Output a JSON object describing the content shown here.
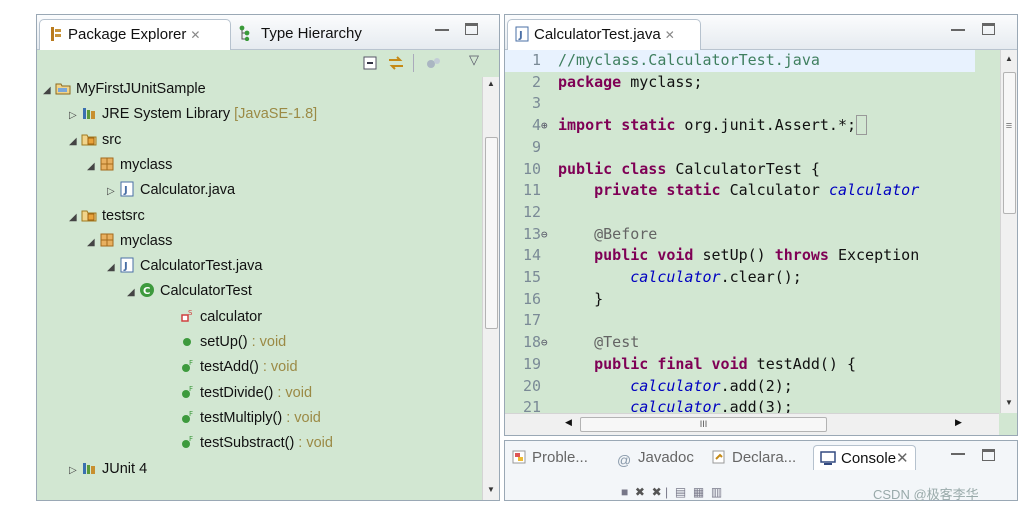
{
  "package_explorer": {
    "tab_label": "Package Explorer",
    "close_glyph": "✕",
    "type_hierarchy_label": "Type Hierarchy",
    "tree": [
      {
        "label": "MyFirstJUnitSample",
        "suffix": "",
        "icon": "project-icon",
        "twisty": "◢"
      },
      {
        "label": "JRE System Library",
        "suffix": "[JavaSE-1.8]",
        "icon": "library-icon",
        "twisty": "▷"
      },
      {
        "label": "src",
        "suffix": "",
        "icon": "source-folder-icon",
        "twisty": "◢"
      },
      {
        "label": "myclass",
        "suffix": "",
        "icon": "package-icon",
        "twisty": "◢"
      },
      {
        "label": "Calculator.java",
        "suffix": "",
        "icon": "java-file-icon",
        "twisty": "▷"
      },
      {
        "label": "testsrc",
        "suffix": "",
        "icon": "source-folder-icon",
        "twisty": "◢"
      },
      {
        "label": "myclass",
        "suffix": "",
        "icon": "package-icon",
        "twisty": "◢"
      },
      {
        "label": "CalculatorTest.java",
        "suffix": "",
        "icon": "java-file-icon",
        "twisty": "◢"
      },
      {
        "label": "CalculatorTest",
        "suffix": "",
        "icon": "class-icon",
        "twisty": "◢"
      },
      {
        "label": "calculator",
        "suffix": "",
        "icon": "static-field-icon",
        "twisty": ""
      },
      {
        "label": "setUp()",
        "suffix": ": void",
        "icon": "public-method-icon",
        "twisty": ""
      },
      {
        "label": "testAdd()",
        "suffix": ": void",
        "icon": "final-method-icon",
        "twisty": ""
      },
      {
        "label": "testDivide()",
        "suffix": ": void",
        "icon": "final-method-icon",
        "twisty": ""
      },
      {
        "label": "testMultiply()",
        "suffix": ": void",
        "icon": "final-method-icon",
        "twisty": ""
      },
      {
        "label": "testSubstract()",
        "suffix": ": void",
        "icon": "final-method-icon",
        "twisty": ""
      },
      {
        "label": "JUnit 4",
        "suffix": "",
        "icon": "library-icon",
        "twisty": "▷"
      }
    ]
  },
  "editor": {
    "tab_label": "CalculatorTest.java",
    "close_glyph": "✕",
    "lines": [
      {
        "n": "1",
        "fold": "",
        "html": "<span class=\"cm\">//myclass.CalculatorTest.java</span>"
      },
      {
        "n": "2",
        "fold": "",
        "html": "<span class=\"kw\">package</span> myclass;"
      },
      {
        "n": "3",
        "fold": "",
        "html": ""
      },
      {
        "n": "4",
        "fold": "⊕",
        "html": "<span class=\"kw\">import</span> <span class=\"kw\">static</span> org.junit.Assert.*;<span style=\"border:1px solid #999;\">&nbsp;</span>"
      },
      {
        "n": "9",
        "fold": "",
        "html": ""
      },
      {
        "n": "10",
        "fold": "",
        "html": "<span class=\"kw\">public</span> <span class=\"kw\">class</span> CalculatorTest {"
      },
      {
        "n": "11",
        "fold": "",
        "html": "    <span class=\"kw\">private</span> <span class=\"kw\">static</span> Calculator <span class=\"fld\">calculator</span>"
      },
      {
        "n": "12",
        "fold": "",
        "html": ""
      },
      {
        "n": "13",
        "fold": "⊖",
        "html": "    <span class=\"ann\">@Before</span>"
      },
      {
        "n": "14",
        "fold": "",
        "html": "    <span class=\"kw\">public</span> <span class=\"kw\">void</span> setUp() <span class=\"kw\">throws</span> Exception"
      },
      {
        "n": "15",
        "fold": "",
        "html": "        <span class=\"fld\">calculator</span>.clear();"
      },
      {
        "n": "16",
        "fold": "",
        "html": "    }"
      },
      {
        "n": "17",
        "fold": "",
        "html": ""
      },
      {
        "n": "18",
        "fold": "⊖",
        "html": "    <span class=\"ann\">@Test</span>"
      },
      {
        "n": "19",
        "fold": "",
        "html": "    <span class=\"kw\">public</span> <span class=\"kw\">final</span> <span class=\"kw\">void</span> testAdd() {"
      },
      {
        "n": "20",
        "fold": "",
        "html": "        <span class=\"fld\">calculator</span>.add(2);"
      },
      {
        "n": "21",
        "fold": "",
        "html": "        <span class=\"fld\">calculator</span>.add(3);"
      }
    ],
    "hscroll_thumb_label": "III"
  },
  "bottom_panel": {
    "tabs": [
      {
        "label": "Proble...",
        "icon": "problems-icon"
      },
      {
        "label": "Javadoc",
        "icon": "javadoc-icon"
      },
      {
        "label": "Declara...",
        "icon": "declaration-icon"
      },
      {
        "label": "Console",
        "icon": "console-icon"
      }
    ]
  },
  "watermark": "CSDN @极客李华",
  "colors": {
    "panel_bg": "#d2e7d2",
    "keyword": "#7f0055",
    "comment": "#3f7f5f",
    "field": "#0000c0"
  }
}
